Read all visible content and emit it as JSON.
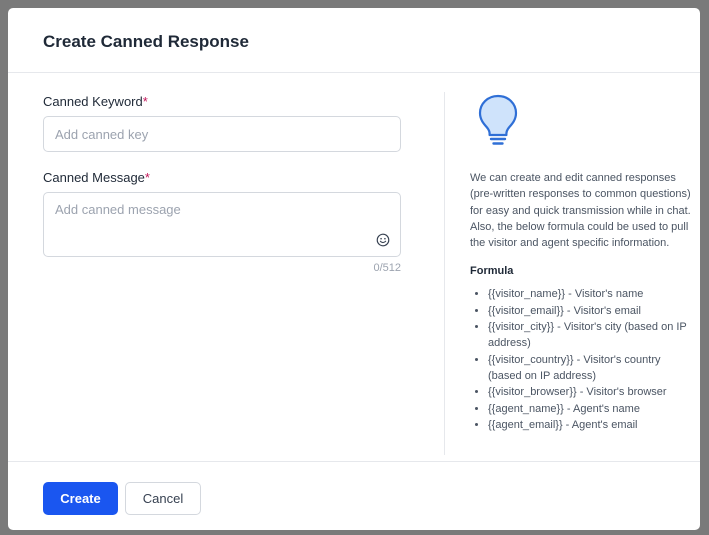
{
  "modal": {
    "title": "Create Canned Response"
  },
  "form": {
    "keyword": {
      "label": "Canned Keyword",
      "required_mark": "*",
      "placeholder": "Add canned key",
      "value": ""
    },
    "message": {
      "label": "Canned Message",
      "required_mark": "*",
      "placeholder": "Add canned message",
      "value": "",
      "char_count": "0/512"
    }
  },
  "info": {
    "icon": "lightbulb-icon",
    "description": "We can create and edit canned responses (pre-written responses to common questions) for easy and quick transmission while in chat. Also, the below formula could be used to pull the visitor and agent specific information.",
    "formula_title": "Formula",
    "formulas": [
      "{{visitor_name}} - Visitor's name",
      "{{visitor_email}} - Visitor's email",
      "{{visitor_city}} - Visitor's city (based on IP address)",
      "{{visitor_country}} - Visitor's country (based on IP address)",
      "{{visitor_browser}} - Visitor's browser",
      "{{agent_name}} - Agent's name",
      "{{agent_email}} - Agent's email"
    ]
  },
  "footer": {
    "create_label": "Create",
    "cancel_label": "Cancel"
  },
  "colors": {
    "primary": "#1a56f0",
    "required": "#c2185b",
    "bulb_fill": "#cfe3fb",
    "bulb_stroke": "#2f6fd6"
  }
}
